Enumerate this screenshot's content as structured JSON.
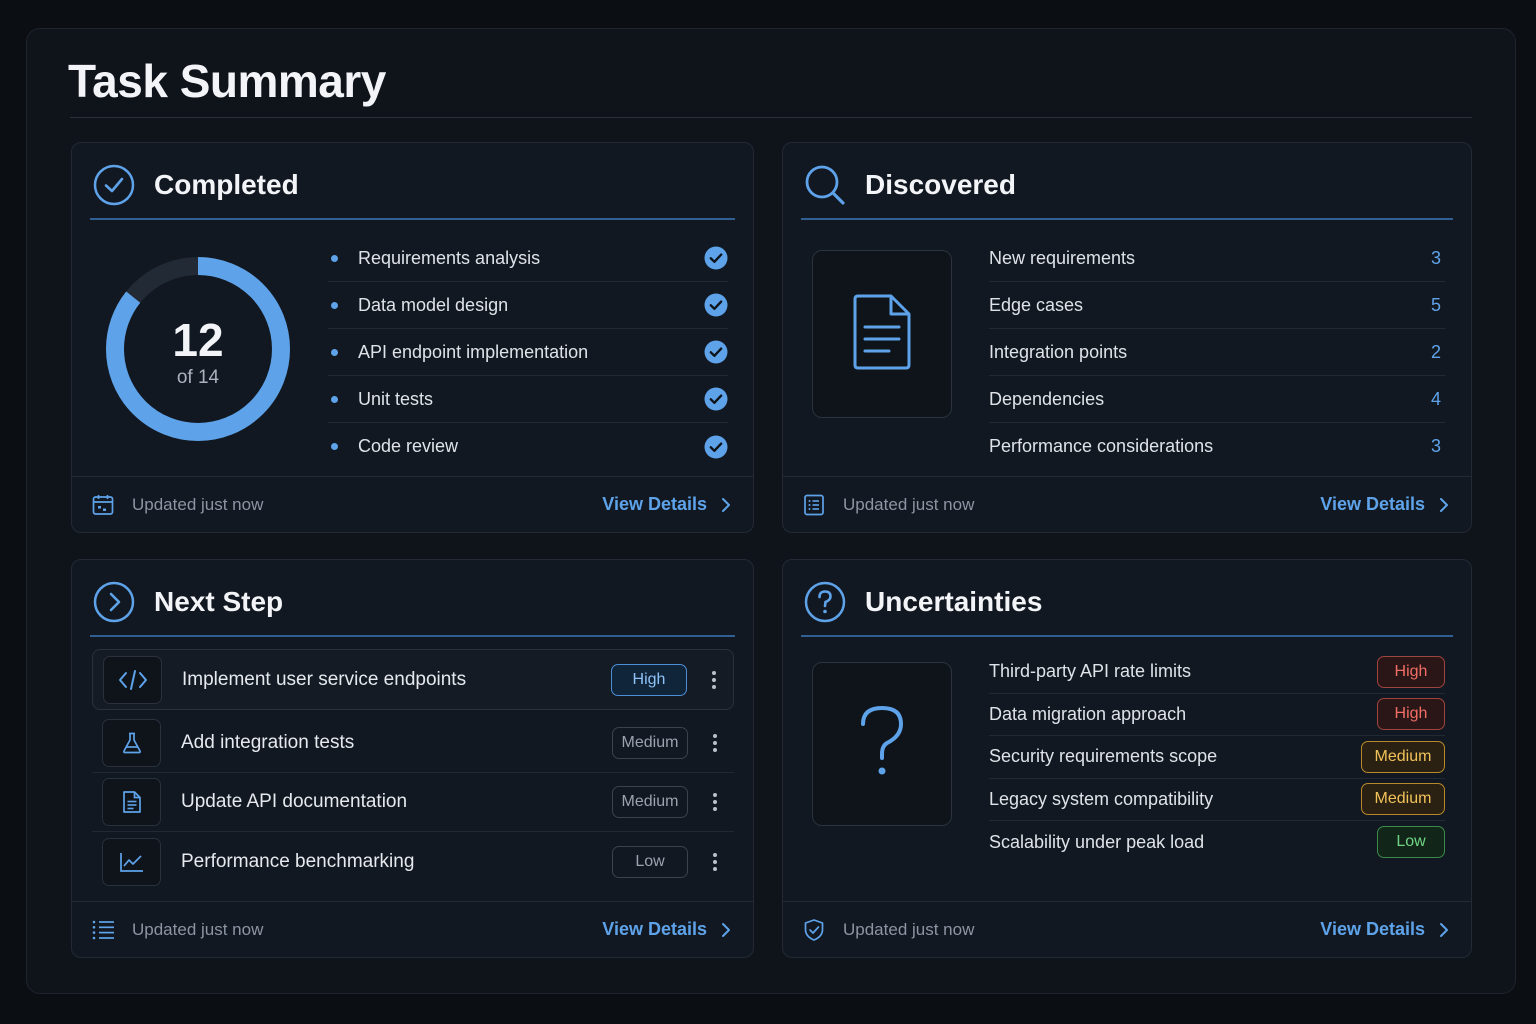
{
  "page": {
    "title": "Task Summary"
  },
  "colors": {
    "accent": "#5ea3ea",
    "high": "#f06e66",
    "medium": "#f2c25a",
    "low": "#6fd585"
  },
  "completed": {
    "title": "Completed",
    "done": 12,
    "total": 14,
    "count_text": "12",
    "of_text": "of 14",
    "items": [
      {
        "label": "Requirements analysis",
        "done": true
      },
      {
        "label": "Data model design",
        "done": true
      },
      {
        "label": "API endpoint implementation",
        "done": true
      },
      {
        "label": "Unit tests",
        "done": true
      },
      {
        "label": "Code review",
        "done": true
      }
    ],
    "footer": {
      "status": "Updated just now",
      "link": "View Details",
      "icon": "calendar-icon"
    }
  },
  "discovered": {
    "title": "Discovered",
    "items": [
      {
        "label": "New requirements",
        "count": "3"
      },
      {
        "label": "Edge cases",
        "count": "5"
      },
      {
        "label": "Integration points",
        "count": "2"
      },
      {
        "label": "Dependencies",
        "count": "4"
      },
      {
        "label": "Performance considerations",
        "count": "3"
      }
    ],
    "footer": {
      "status": "Updated just now",
      "link": "View Details",
      "icon": "list-doc-icon"
    }
  },
  "next_step": {
    "title": "Next Step",
    "items": [
      {
        "label": "Implement user service endpoints",
        "priority": "High",
        "icon": "code-icon"
      },
      {
        "label": "Add integration tests",
        "priority": "Medium",
        "icon": "flask-icon"
      },
      {
        "label": "Update API documentation",
        "priority": "Medium",
        "icon": "document-icon"
      },
      {
        "label": "Performance benchmarking",
        "priority": "Low",
        "icon": "line-chart-icon"
      }
    ],
    "footer": {
      "status": "Updated just now",
      "link": "View Details",
      "icon": "list-icon"
    }
  },
  "uncertainties": {
    "title": "Uncertainties",
    "items": [
      {
        "label": "Third-party API rate limits",
        "level": "High"
      },
      {
        "label": "Data migration approach",
        "level": "High"
      },
      {
        "label": "Security requirements scope",
        "level": "Medium"
      },
      {
        "label": "Legacy system compatibility",
        "level": "Medium"
      },
      {
        "label": "Scalability under peak load",
        "level": "Low"
      }
    ],
    "footer": {
      "status": "Updated just now",
      "link": "View Details",
      "icon": "shield-icon"
    }
  }
}
